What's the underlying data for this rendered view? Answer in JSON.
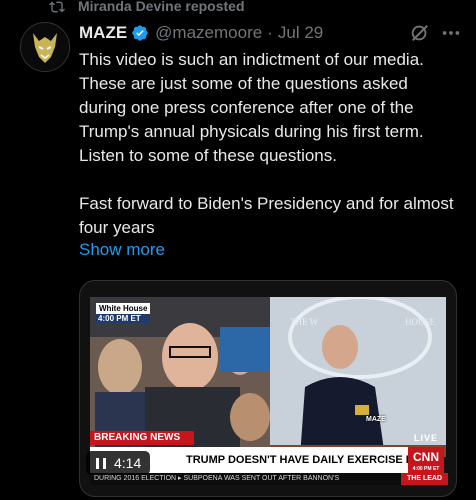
{
  "repost": {
    "text": "Miranda Devine reposted"
  },
  "tweet": {
    "name": "MAZE",
    "handle": "@mazemoore",
    "separator": "·",
    "date": "Jul 29",
    "body": "This video is such an indictment of our media. These are just some of the questions asked during one press conference after one of the Trump's annual physicals during his first term. Listen to some of these questions.\n\nFast forward to Biden's Presidency and for almost four years",
    "show_more": "Show more"
  },
  "video": {
    "pip_source": "White House",
    "pip_time": "4:00 PM ET",
    "breaking": "BREAKING NEWS",
    "headline": "TRUMP DOESN'T HAVE DAILY EXERCISE PROGRAM",
    "live": "LIVE",
    "network": "CNN",
    "network_time": "4:00 PM ET",
    "watermark": "MAZE",
    "ticker": "DURING 2016 ELECTION  ▸ SUBPOENA WAS SENT OUT AFTER BANNON'S",
    "ticker_lead": "THE LEAD",
    "duration": "4:14"
  },
  "icons": {
    "repost": "repost-icon",
    "verified": "verified-badge-icon",
    "grok": "grok-icon",
    "more": "more-icon",
    "pause": "pause-icon"
  },
  "colors": {
    "accent": "#1d9bf0",
    "muted": "#71767b",
    "breaking": "#c4161c"
  }
}
